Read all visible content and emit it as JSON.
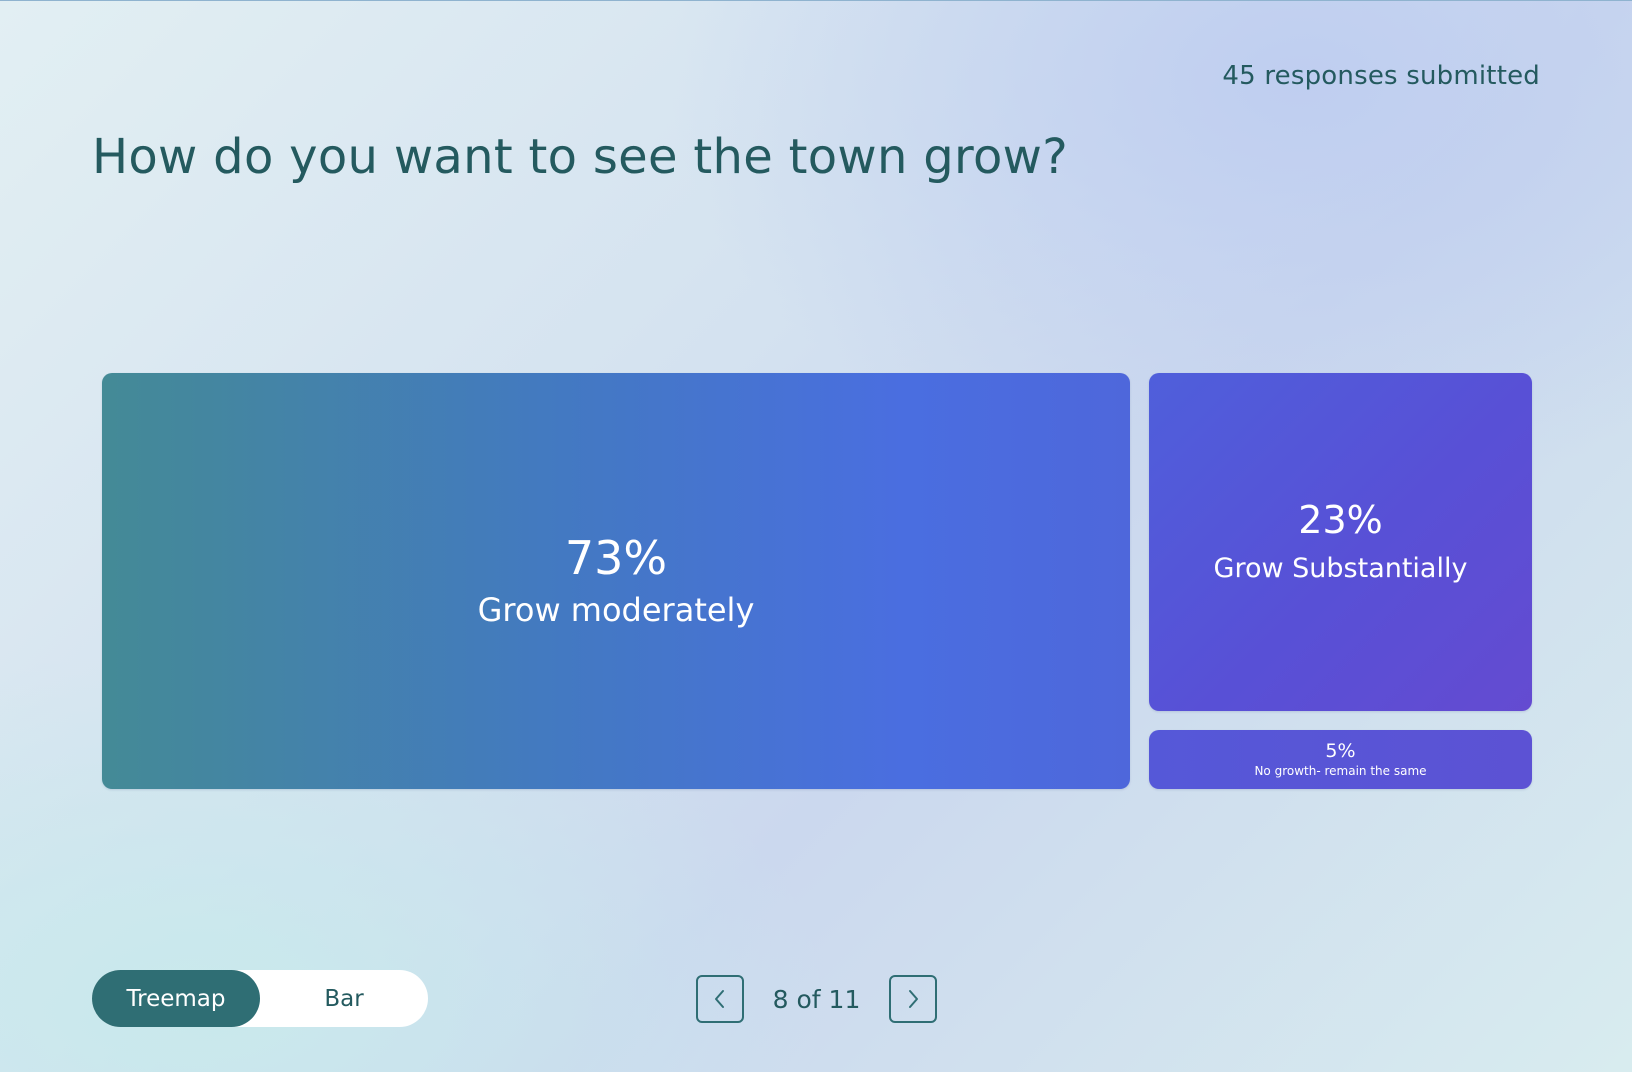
{
  "header": {
    "responses": "45 responses submitted",
    "question": "How do you want to see the town grow?"
  },
  "chart_data": {
    "type": "treemap",
    "items": [
      {
        "label": "Grow moderately",
        "percent": "73%",
        "value": 73
      },
      {
        "label": "Grow Substantially",
        "percent": "23%",
        "value": 23
      },
      {
        "label": "No growth- remain the same",
        "percent": "5%",
        "value": 5
      }
    ]
  },
  "view_toggle": {
    "options": [
      "Treemap",
      "Bar"
    ],
    "selected": "Treemap"
  },
  "pager": {
    "label": "8 of 11",
    "prev_icon": "chevron-left-icon",
    "next_icon": "chevron-right-icon"
  },
  "colors": {
    "text": "#245a5f",
    "toggle_active": "#2f6e74",
    "tile_moderate_start": "#448a96",
    "tile_moderate_end": "#4e67db",
    "tile_substantial": "#5850d6",
    "tile_none": "#5856d6"
  }
}
